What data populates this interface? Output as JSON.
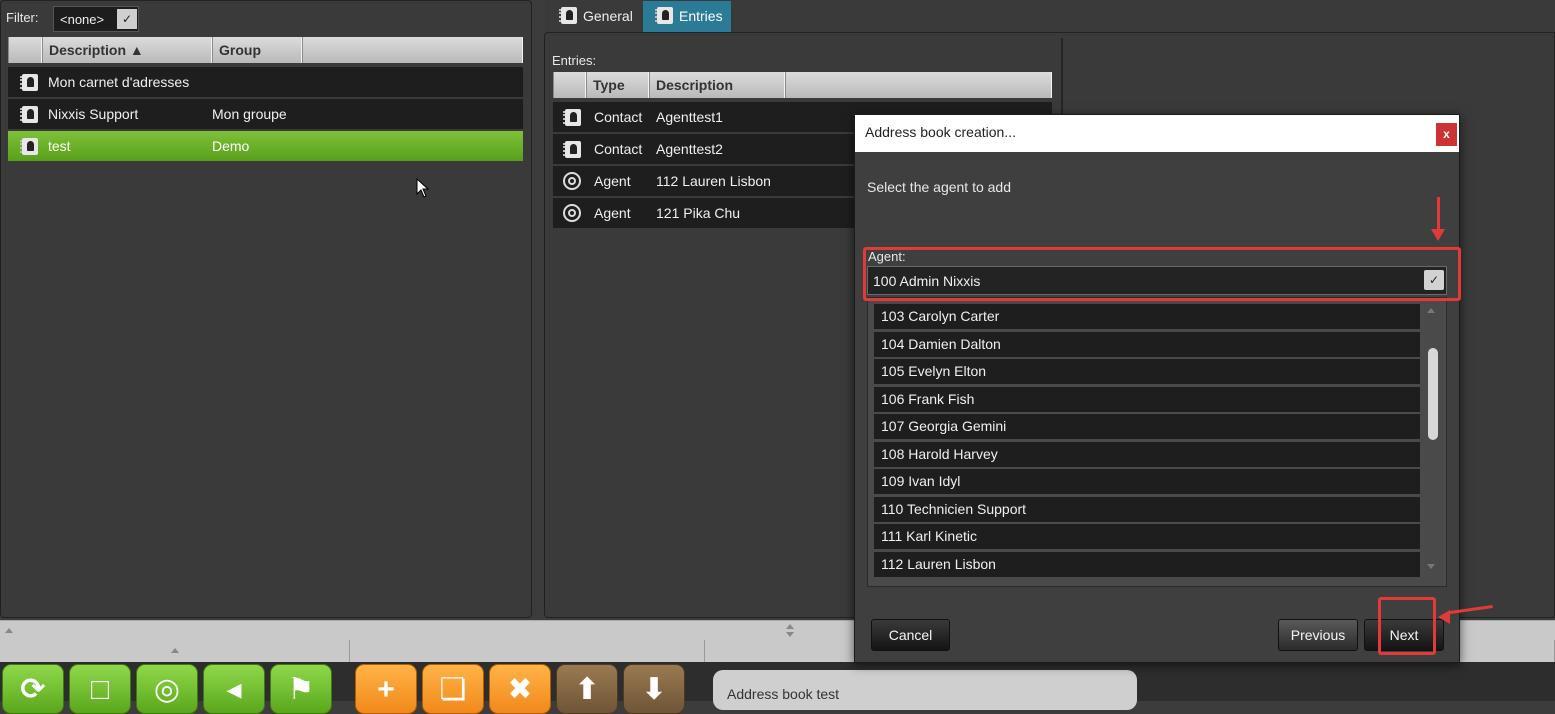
{
  "left_panel": {
    "filter_label": "Filter:",
    "filter_value": "<none>",
    "columns": [
      "Description ▲",
      "Group"
    ],
    "rows": [
      {
        "description": "Mon carnet d'adresses",
        "group": "",
        "selected": false
      },
      {
        "description": "Nixxis Support",
        "group": "Mon groupe",
        "selected": false
      },
      {
        "description": "test",
        "group": "Demo",
        "selected": true
      }
    ]
  },
  "right_panel": {
    "tabs": [
      {
        "label": "General",
        "active": false
      },
      {
        "label": "Entries",
        "active": true
      }
    ],
    "entries_label": "Entries:",
    "columns": [
      "Type",
      "Description"
    ],
    "entries": [
      {
        "type": "Contact",
        "description": "Agenttest1",
        "icon": "address-book-icon"
      },
      {
        "type": "Contact",
        "description": "Agenttest2",
        "icon": "address-book-icon"
      },
      {
        "type": "Agent",
        "description": "112 Lauren Lisbon",
        "icon": "agent-icon"
      },
      {
        "type": "Agent",
        "description": "121 Pika Chu",
        "icon": "agent-icon"
      }
    ]
  },
  "dialog": {
    "title": "Address book creation...",
    "close_label": "x",
    "prompt": "Select the agent to add",
    "agent_label": "Agent:",
    "agent_selected": "100 Admin Nixxis",
    "agent_options": [
      "103 Carolyn Carter",
      "104 Damien Dalton",
      "105 Evelyn Elton",
      "106 Frank Fish",
      "107 Georgia Gemini",
      "108 Harold Harvey",
      "109 Ivan Idyl",
      "110 Technicien Support",
      "111 Karl Kinetic",
      "112 Lauren Lisbon"
    ],
    "buttons": {
      "cancel": "Cancel",
      "previous": "Previous",
      "next": "Next"
    }
  },
  "bottom": {
    "info_text": "Address book test"
  },
  "colors": {
    "selection_green": "#6ab02a",
    "active_tab": "#2b7b96",
    "annotation_red": "#e23a3a"
  }
}
